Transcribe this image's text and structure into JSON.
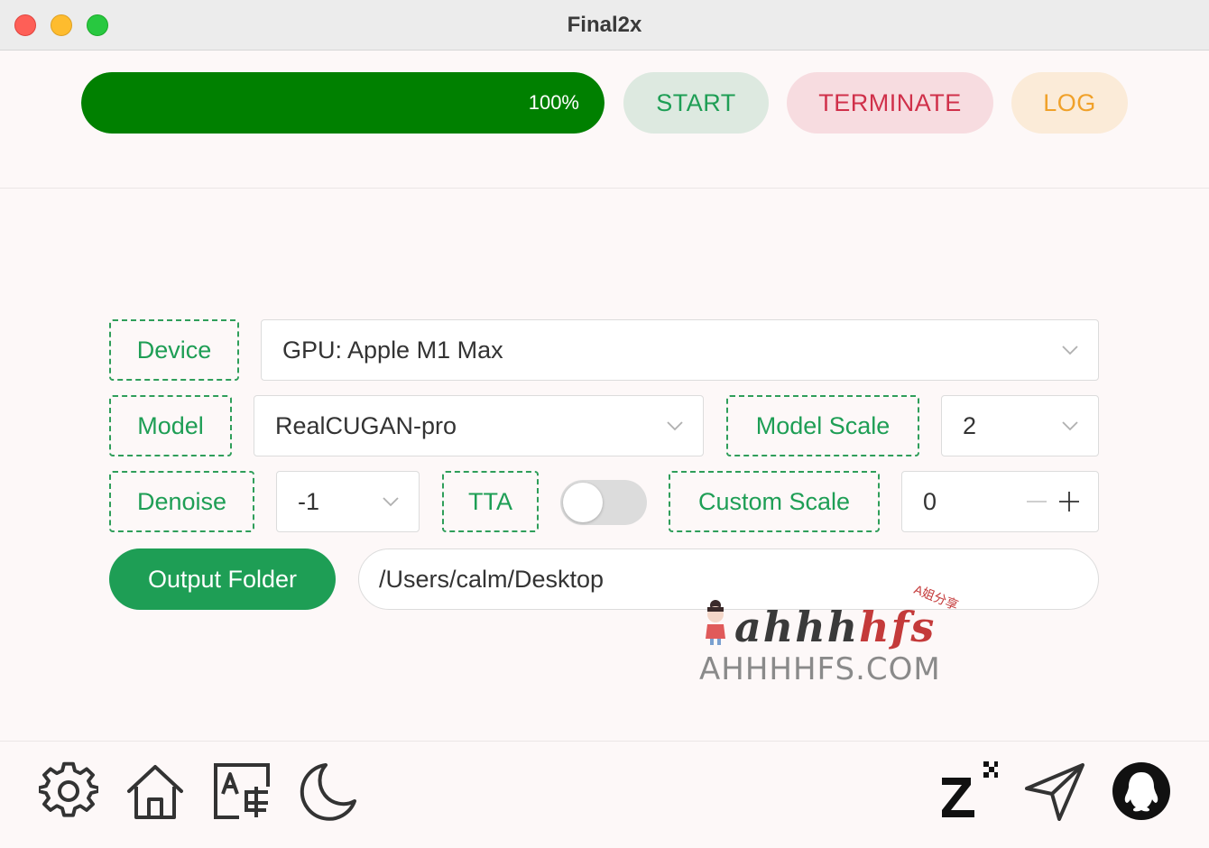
{
  "window": {
    "title": "Final2x"
  },
  "progress": {
    "value": 1.0,
    "label": "100%"
  },
  "toolbar": {
    "start_label": "START",
    "terminate_label": "TERMINATE",
    "log_label": "LOG"
  },
  "settings": {
    "device_label": "Device",
    "device_value": "GPU: Apple M1 Max",
    "model_label": "Model",
    "model_value": "RealCUGAN-pro",
    "model_scale_label": "Model Scale",
    "model_scale_value": "2",
    "denoise_label": "Denoise",
    "denoise_value": "-1",
    "tta_label": "TTA",
    "tta_enabled": false,
    "custom_scale_label": "Custom Scale",
    "custom_scale_value": "0"
  },
  "output": {
    "button_label": "Output Folder",
    "path": "/Users/calm/Desktop"
  },
  "watermark": {
    "logo_main": "ahhh",
    "logo_accent": "hfs",
    "logo_small": "A姐分享",
    "url": "AHHHHFS.COM"
  },
  "bottom_icons": {
    "left": [
      "gear-icon",
      "home-icon",
      "translate-icon",
      "moon-icon"
    ],
    "right": [
      "sleep-z-icon",
      "send-icon",
      "qq-icon"
    ]
  },
  "colors": {
    "accent": "#1e9e55",
    "progress": "#008000",
    "danger": "#d0304a",
    "warning": "#f0a12a"
  }
}
